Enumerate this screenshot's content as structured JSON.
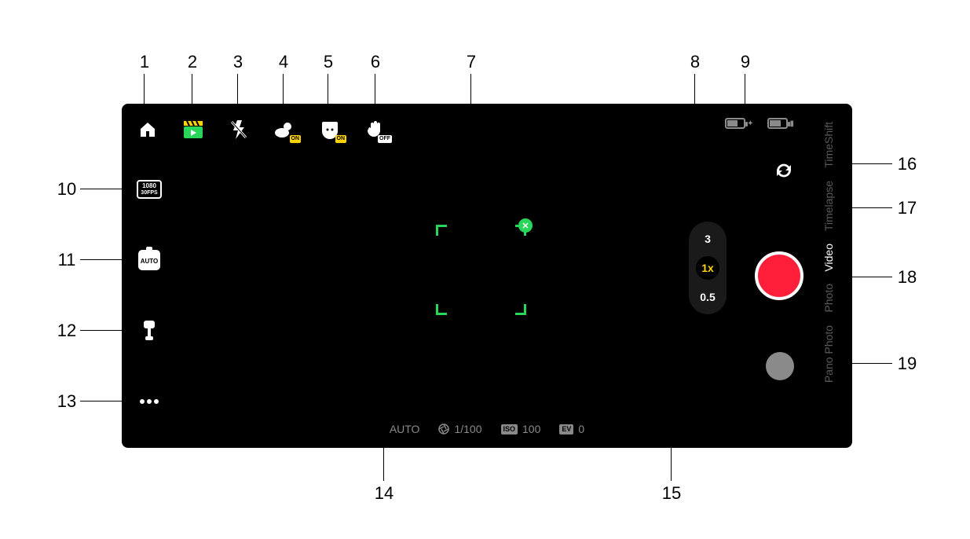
{
  "callouts": {
    "n1": "1",
    "n2": "2",
    "n3": "3",
    "n4": "4",
    "n5": "5",
    "n6": "6",
    "n7": "7",
    "n8": "8",
    "n9": "9",
    "n10": "10",
    "n11": "11",
    "n12": "12",
    "n13": "13",
    "n14": "14",
    "n15": "15",
    "n16": "16",
    "n17": "17",
    "n18": "18",
    "n19": "19"
  },
  "top_icons": {
    "home": "home-icon",
    "shot_guides": "clapper-icon",
    "flash": "flash-off-icon",
    "hdr": {
      "icon": "cloud-sun-icon",
      "badge": "ON"
    },
    "beauty": {
      "icon": "face-icon",
      "badge": "ON"
    },
    "gesture": {
      "icon": "hand-icon",
      "badge": "OFF"
    }
  },
  "batteries": {
    "gimbal": {
      "level_pct": 60,
      "sub": "✦"
    },
    "phone": {
      "level_pct": 60,
      "sub": "▮"
    }
  },
  "left_icons": {
    "resolution": {
      "line1": "1080",
      "line2": "30FPS"
    },
    "auto": "AUTO",
    "gimbal": "gimbal-icon",
    "more": "more-icon"
  },
  "focus_box": {
    "close_glyph": "✕"
  },
  "switch_camera": "switch-camera-icon",
  "zoom": {
    "options": [
      "3",
      "1x",
      "0.5"
    ],
    "active_index": 1
  },
  "shutter": "shutter-button",
  "gallery": "gallery-thumb",
  "modes": {
    "items": [
      "TimeShift",
      "Timelapse",
      "Video",
      "Photo",
      "Pano Photo"
    ],
    "active_index": 2
  },
  "bottom": {
    "auto_label": "AUTO",
    "shutter_value": "1/100",
    "iso_label": "ISO",
    "iso_value": "100",
    "ev_label": "EV",
    "ev_value": "0"
  }
}
